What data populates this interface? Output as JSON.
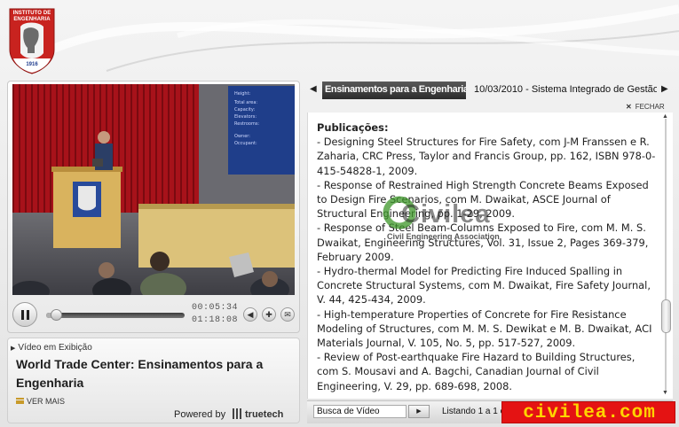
{
  "logo": {
    "name_line1": "INSTITUTO DE",
    "name_line2": "ENGENHARIA",
    "year": "1916"
  },
  "player": {
    "elapsed": "00:05:34",
    "duration": "01:18:08",
    "progress_fraction": 0.071,
    "volume_icon": "speaker-icon",
    "fullscreen_icon": "fullscreen-icon",
    "share_icon": "envelope-icon"
  },
  "now_playing": {
    "label": "Vídeo em Exibição",
    "title": "World Trade Center: Ensinamentos para a Engenharia",
    "more_label": "VER MAIS"
  },
  "branding": {
    "powered_by": "Powered by",
    "vendor": "truetech"
  },
  "tabs": {
    "active_label": "Ensinamentos para a Engenharia",
    "next_label": "10/03/2010 - Sistema Integrado de Gestão"
  },
  "close_label": "FECHAR",
  "article": {
    "heading": "Publicações:",
    "paragraphs": [
      "- Designing Steel Structures for Fire Safety, com J-M Franssen e R. Zaharia, CRC Press, Taylor and Francis Group, pp. 162, ISBN 978-0-415-54828-1, 2009.",
      "- Response of Restrained High Strength Concrete Beams Exposed to Design Fire Scenarios, com M. Dwaikat, ASCE Journal of Structural Engineering, pp. 1-29, 2009.",
      "- Response of Steel Beam-Columns Exposed to Fire, com M. M. S. Dwaikat, Engineering Structures, Vol. 31, Issue 2, Pages 369-379, February 2009.",
      "- Hydro-thermal Model for Predicting Fire Induced Spalling in Concrete Structural Systems, com M. Dwaikat, Fire Safety Journal, V. 44, 425-434, 2009.",
      "- High-temperature Properties of Concrete for Fire Resistance Modeling of Structures, com M. M. S. Dewikat e M. B. Dwaikat, ACI Materials Journal, V. 105, No. 5, pp. 517-527, 2009.",
      "- Review of Post-earthquake Fire Hazard to Building Structures, com S. Mousavi and A. Bagchi, Canadian Journal of Civil Engineering, V. 29, pp. 689-698, 2008."
    ]
  },
  "watermark": {
    "word": "Civilea",
    "sub": "Civil Engineering Association",
    "badge": "civilea.com"
  },
  "search": {
    "selected": "Busca de Vídeo",
    "listing": "Listando 1 a 1 c"
  }
}
